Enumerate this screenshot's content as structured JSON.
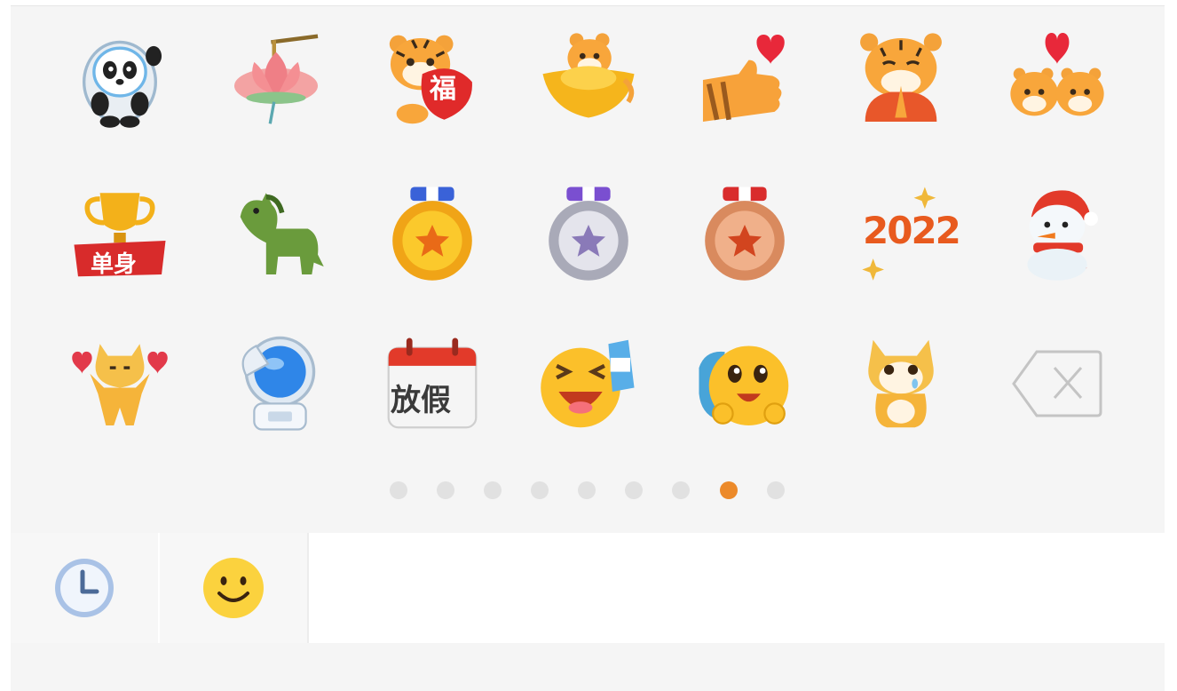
{
  "stickers": [
    {
      "name": "bing-dwen-dwen-panda"
    },
    {
      "name": "lotus-lantern"
    },
    {
      "name": "tiger-holding-fu",
      "text": "福"
    },
    {
      "name": "tiger-gold-ingot"
    },
    {
      "name": "tiger-paw-heart"
    },
    {
      "name": "tiger-praying"
    },
    {
      "name": "two-tigers-heart"
    },
    {
      "name": "single-trophy",
      "text": "单身"
    },
    {
      "name": "green-horse"
    },
    {
      "name": "gold-medal"
    },
    {
      "name": "silver-medal"
    },
    {
      "name": "bronze-medal"
    },
    {
      "name": "2022-sparkle",
      "text": "2022"
    },
    {
      "name": "snowman"
    },
    {
      "name": "shiba-hearts"
    },
    {
      "name": "astronaut-salute"
    },
    {
      "name": "holiday-calendar",
      "text": "放假"
    },
    {
      "name": "laughing-face-drink"
    },
    {
      "name": "emoji-backpack"
    },
    {
      "name": "crying-shiba"
    },
    {
      "name": "delete-key"
    }
  ],
  "pager": {
    "total": 9,
    "active_index": 7
  },
  "tabs": [
    {
      "name": "recent",
      "icon": "clock-icon"
    },
    {
      "name": "emoji",
      "icon": "smiley-icon"
    }
  ],
  "colors": {
    "accent": "#ec8a2a",
    "dot_inactive": "#e1e1e1",
    "panel_bg": "#f5f5f5"
  }
}
